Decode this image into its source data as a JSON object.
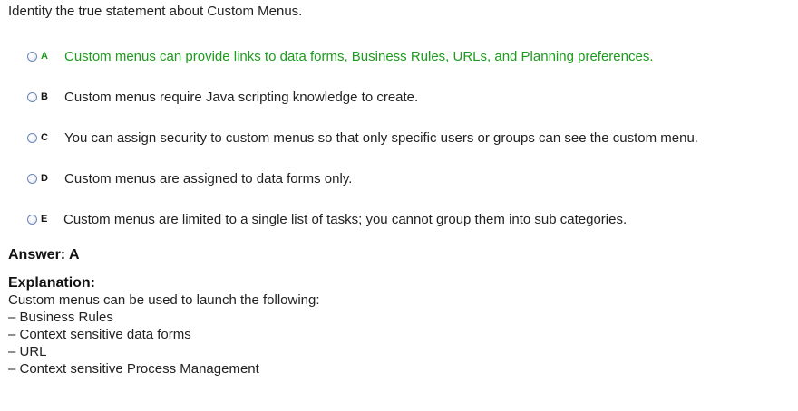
{
  "question": "Identity the true statement about Custom Menus.",
  "options": [
    {
      "letter": "A",
      "text": "Custom menus can provide links to data forms, Business Rules, URLs, and Planning preferences.",
      "correct": true
    },
    {
      "letter": "B",
      "text": "Custom menus require Java scripting knowledge to create.",
      "correct": false
    },
    {
      "letter": "C",
      "text": "You can assign security to custom menus so that only specific users or groups can see the custom menu.",
      "correct": false
    },
    {
      "letter": "D",
      "text": "Custom menus are assigned to data forms only.",
      "correct": false
    },
    {
      "letter": "E",
      "text": "Custom menus are limited to a single list of tasks; you cannot group them into sub categories.",
      "correct": false
    }
  ],
  "answer": "Answer: A",
  "explanation": {
    "title": "Explanation:",
    "intro": "Custom menus can be used to launch the following:",
    "items": [
      "– Business Rules",
      "– Context sensitive data forms",
      "– URL",
      "– Context sensitive Process Management"
    ]
  },
  "colors": {
    "correct_text": "#1c9b1c",
    "radio_border": "#6d86b4",
    "body_text": "#222222"
  }
}
